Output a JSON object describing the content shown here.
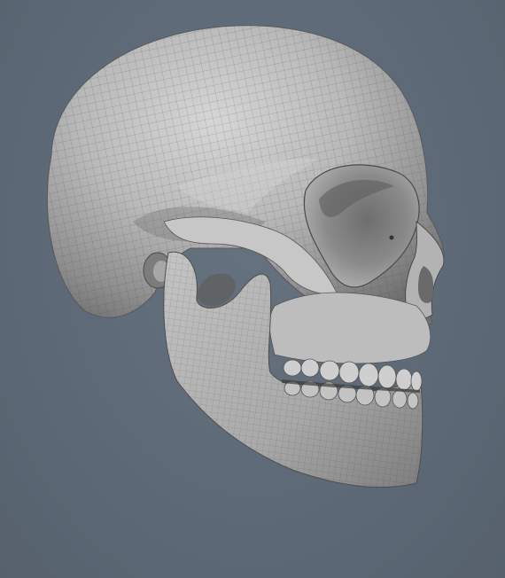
{
  "viewport": {
    "background_color": "#5e6a78",
    "subject": "skull-wireframe-render",
    "mesh_color": "#3c3c3c",
    "surface_color": "#b8b8b8"
  }
}
